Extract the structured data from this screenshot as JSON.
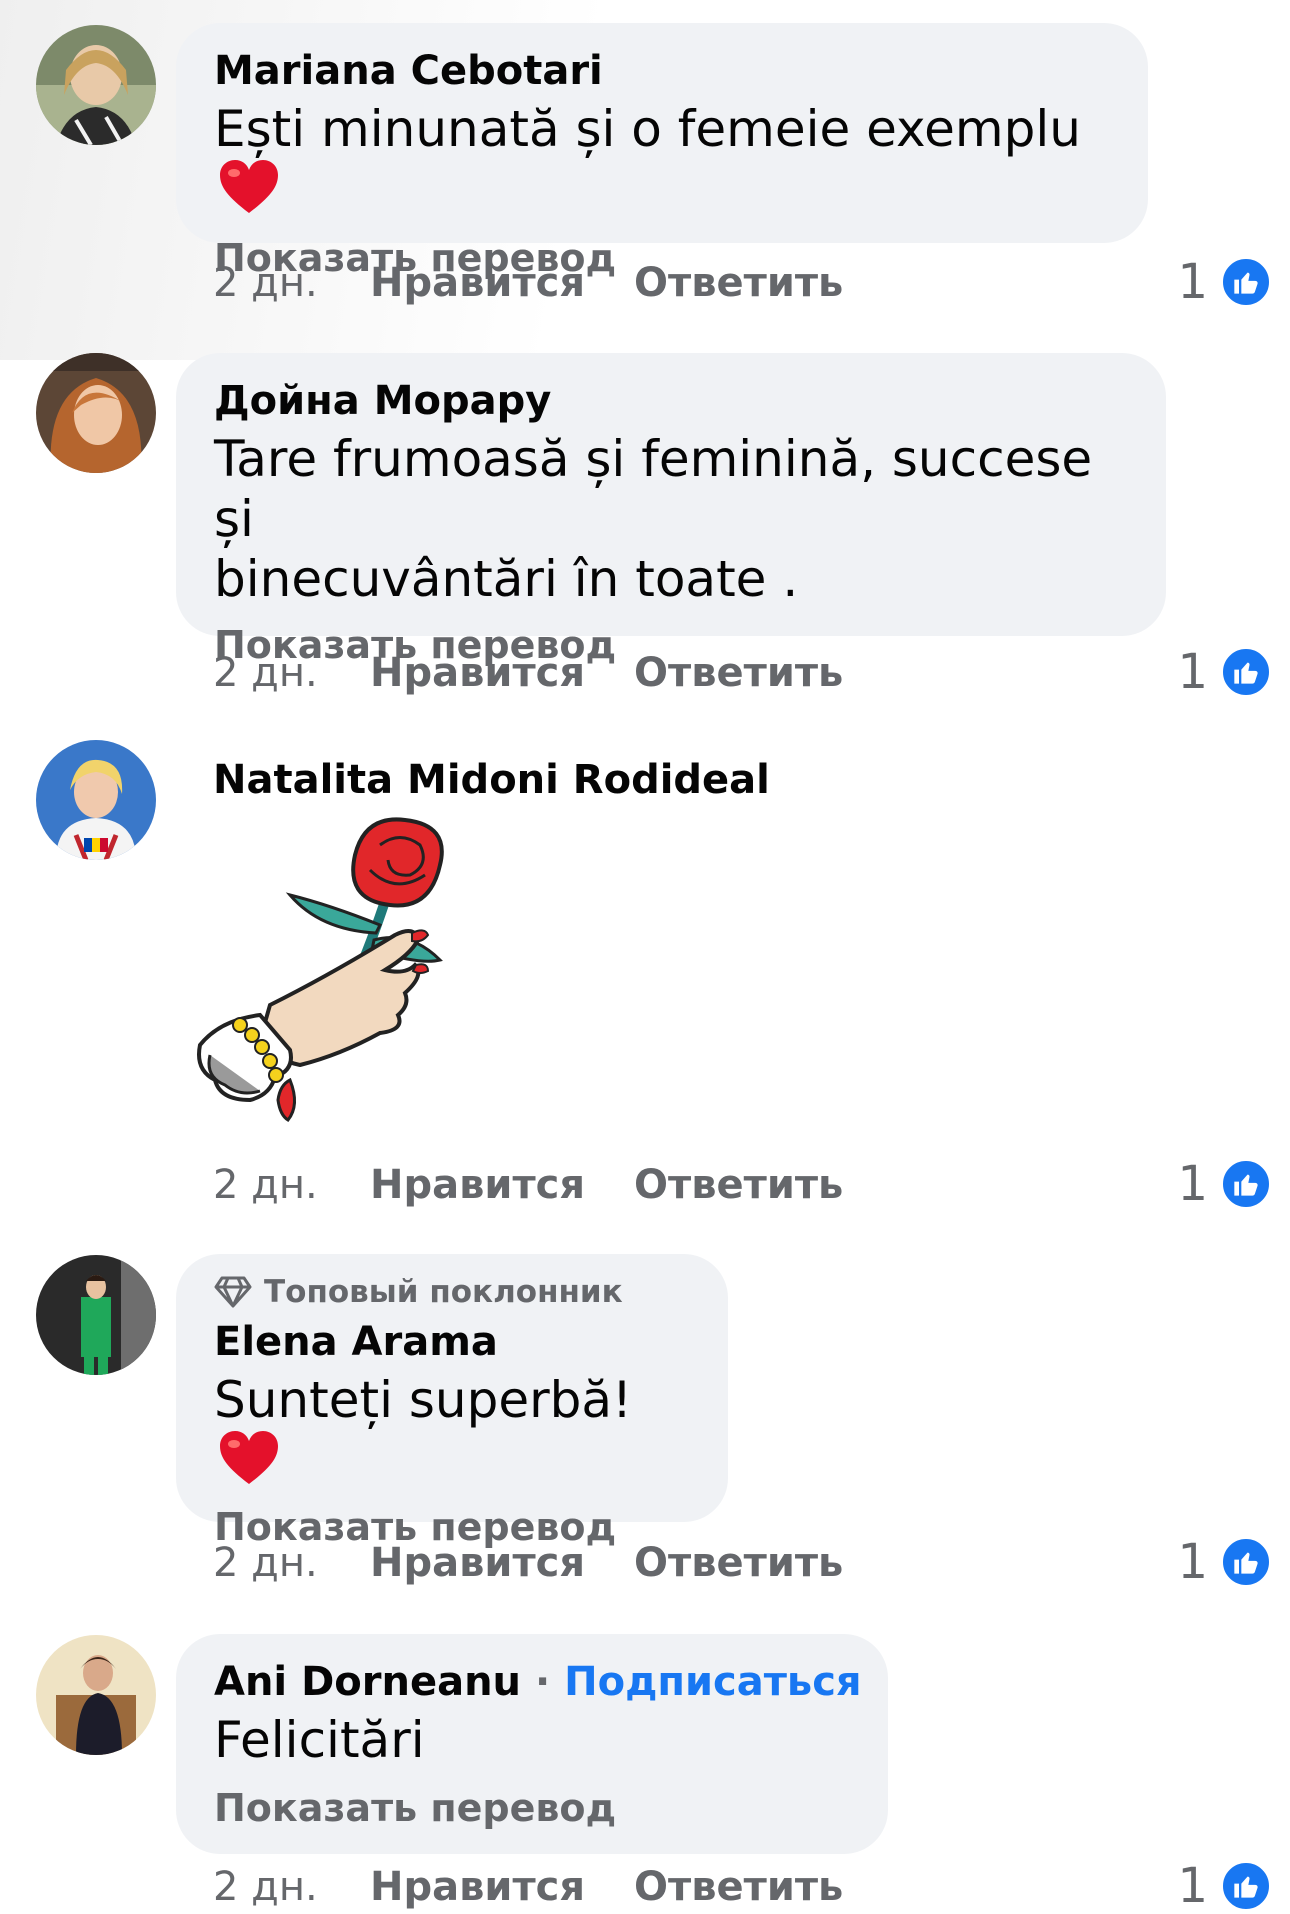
{
  "actions": {
    "time": "2 дн.",
    "like": "Нравится",
    "reply": "Ответить",
    "translate": "Показать перевод",
    "reaction_count": "1"
  },
  "comments": [
    {
      "author": "Mariana Cebotari",
      "text": "Ești minunată și o femeie exemplu",
      "has_heart": true
    },
    {
      "author": "Дойна Морару",
      "text_line1": "Tare frumoasă și feminină, succese și",
      "text_line2": "binecuvântări în toate ."
    },
    {
      "author": "Natalita Midoni Rodideal",
      "sticker": "rose-in-hand-sticker"
    },
    {
      "badge": "Топовый поклонник",
      "author": "Elena Arama",
      "text": "Sunteți superbă!",
      "has_heart": true
    },
    {
      "author": "Ani Dorneanu",
      "separator": "·",
      "follow": "Подписаться",
      "text": "Felicitări"
    }
  ],
  "colors": {
    "bubble": "#f0f2f5",
    "secondary_text": "#65676b",
    "accent_blue": "#1877f2",
    "heart_red": "#e4112b"
  }
}
